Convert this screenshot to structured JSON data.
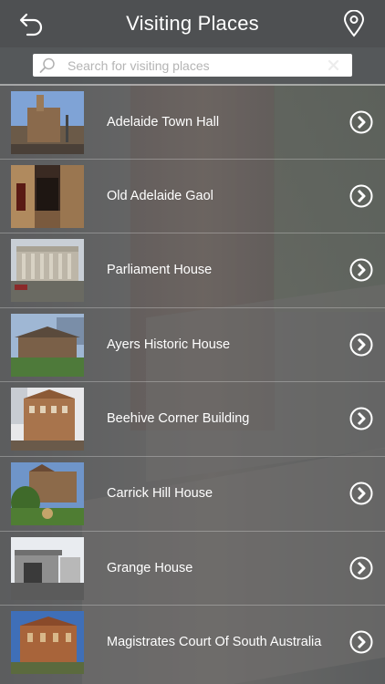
{
  "header": {
    "title": "Visiting Places",
    "back_icon": "back-arrow-icon",
    "location_icon": "map-pin-icon"
  },
  "search": {
    "placeholder": "Search for visiting places",
    "value": ""
  },
  "places": [
    {
      "name": "Adelaide Town Hall",
      "thumb_colors": [
        "#7fa3d6",
        "#8a6a4c",
        "#5a4a3a"
      ]
    },
    {
      "name": "Old Adelaide Gaol",
      "thumb_colors": [
        "#3a2a22",
        "#7a5a3e",
        "#b08a5e"
      ]
    },
    {
      "name": "Parliament House",
      "thumb_colors": [
        "#c9cfd6",
        "#bdb6a8",
        "#6a6a62"
      ]
    },
    {
      "name": "Ayers Historic House",
      "thumb_colors": [
        "#9fb7d4",
        "#7a6048",
        "#4e7a3a"
      ]
    },
    {
      "name": "Beehive Corner Building",
      "thumb_colors": [
        "#e8e8ea",
        "#a8744c",
        "#6a5a4a"
      ]
    },
    {
      "name": "Carrick Hill House",
      "thumb_colors": [
        "#6f95c9",
        "#8c6a4a",
        "#4f7d33"
      ]
    },
    {
      "name": "Grange House",
      "thumb_colors": [
        "#e9ecf0",
        "#8f8f8f",
        "#5b5b5b"
      ]
    },
    {
      "name": "Magistrates Court Of South Australia",
      "thumb_colors": [
        "#3f6fb8",
        "#a8643a",
        "#5b6a3e"
      ]
    }
  ],
  "colors": {
    "header_bg": "#4e5052",
    "text": "#ffffff"
  }
}
